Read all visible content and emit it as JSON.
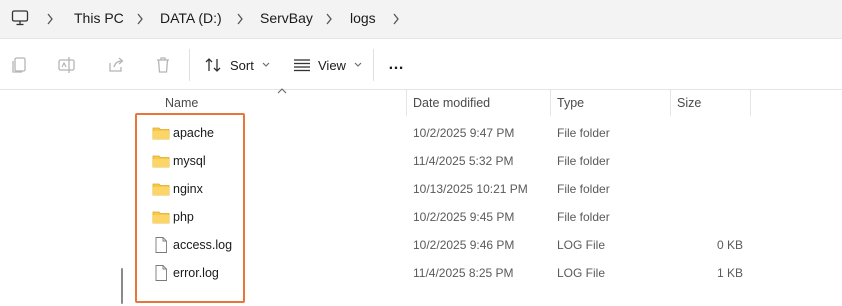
{
  "address_bar": {
    "breadcrumbs": [
      "This PC",
      "DATA (D:)",
      "ServBay",
      "logs"
    ],
    "root_icon": "computer-icon"
  },
  "toolbar": {
    "copy_icon": "copy-icon",
    "rename_icon": "rename-icon",
    "share_icon": "share-icon",
    "delete_icon": "delete-icon",
    "sort_label": "Sort",
    "view_label": "View",
    "more_label": "…"
  },
  "columns": {
    "name": "Name",
    "date": "Date modified",
    "type": "Type",
    "size": "Size"
  },
  "files": [
    {
      "name": "apache",
      "date": "10/2/2025 9:47 PM",
      "type": "File folder",
      "size": "",
      "icon": "folder-icon"
    },
    {
      "name": "mysql",
      "date": "11/4/2025 5:32 PM",
      "type": "File folder",
      "size": "",
      "icon": "folder-icon"
    },
    {
      "name": "nginx",
      "date": "10/13/2025 10:21 PM",
      "type": "File folder",
      "size": "",
      "icon": "folder-icon"
    },
    {
      "name": "php",
      "date": "10/2/2025 9:45 PM",
      "type": "File folder",
      "size": "",
      "icon": "folder-icon"
    },
    {
      "name": "access.log",
      "date": "10/2/2025 9:46 PM",
      "type": "LOG File",
      "size": "0 KB",
      "icon": "file-icon"
    },
    {
      "name": "error.log",
      "date": "11/4/2025 8:25 PM",
      "type": "LOG File",
      "size": "1 KB",
      "icon": "file-icon"
    }
  ],
  "colors": {
    "highlight": "#e8763a",
    "folder": "#f7c84a"
  }
}
